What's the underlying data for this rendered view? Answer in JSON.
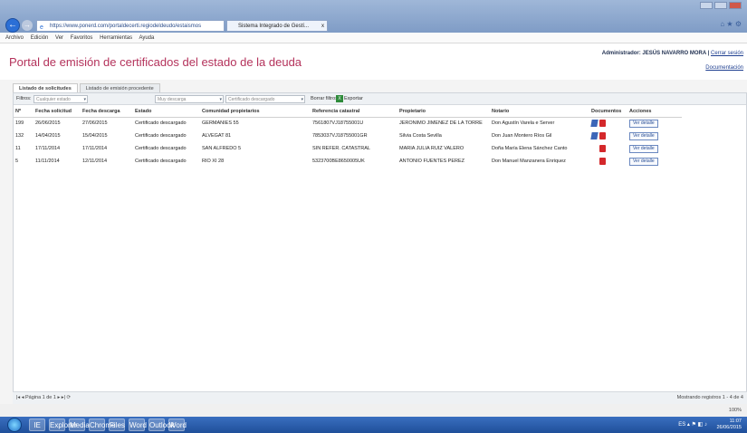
{
  "browser": {
    "address": "https://www.ponerd.com/portaldecerti.regiodeldeudo/estaismos",
    "tab_label": "Sistema Integrado de Gestí...",
    "tab_close": "x"
  },
  "menu": [
    "Archivo",
    "Edición",
    "Ver",
    "Favoritos",
    "Herramientas",
    "Ayuda"
  ],
  "header": {
    "title": "Portal de emisión de certificados del estado de la deuda",
    "user": "Administrador: JESÚS NAVARRO MORA |",
    "logout": "Cerrar sesión",
    "docs": "Documentación"
  },
  "tabs": [
    "Listado de solicitudes",
    "Listado de emisión procedente"
  ],
  "toolbar": {
    "filter_label": "Filtros:",
    "filter1": "Cualquier estado",
    "filter2": "Muy descarga",
    "filter3": "Certificado descargado",
    "clear": "Borrar filtros",
    "export": "Exportar",
    "export_icon": "X"
  },
  "columns": [
    "Nº",
    "Fecha solicitud",
    "Fecha descarga",
    "Estado",
    "Comunidad propietarios",
    "Referencia catastral",
    "Propietario",
    "Notario",
    "Documentos",
    "Acciones"
  ],
  "rows": [
    {
      "n": "199",
      "fsol": "26/06/2015",
      "fdes": "27/06/2015",
      "estado": "Certificado descargado",
      "comunidad": "GERMANIES 55",
      "ref": "7561807VJ18755001U",
      "prop": "JERONIMO JIMENEZ DE LA TORRE",
      "notario": "Don Agustín Varela e Server",
      "docs": "edit,pdf",
      "accion": "Ver detalle"
    },
    {
      "n": "132",
      "fsol": "14/04/2015",
      "fdes": "15/04/2015",
      "estado": "Certificado descargado",
      "comunidad": "ALVEGAT 81",
      "ref": "7853037VJ18755001GR",
      "prop": "Silvia Costa Sevilla",
      "notario": "Don Juan Montero Ríos Gil",
      "docs": "edit,pdf",
      "accion": "Ver detalle"
    },
    {
      "n": "11",
      "fsol": "17/11/2014",
      "fdes": "17/11/2014",
      "estado": "Certificado descargado",
      "comunidad": "SAN ALFREDO 5",
      "ref": "SIN REFER. CATASTRAL",
      "prop": "MARIA JULIA RUIZ VALERO",
      "notario": "Doña María Elena Sánchez Canto",
      "docs": "pdf",
      "accion": "Ver detalle"
    },
    {
      "n": "5",
      "fsol": "11/11/2014",
      "fdes": "12/11/2014",
      "estado": "Certificado descargado",
      "comunidad": "RIO XI 28",
      "ref": "5323700BE8650005UK",
      "prop": "ANTONIO FUENTES PEREZ",
      "notario": "Don Manuel Manzanera Enriquez",
      "docs": "pdf",
      "accion": "Ver detalle"
    }
  ],
  "footer": {
    "pager": "|◂  ◂  Página  1 de 1  ▸  ▸|  ⟳",
    "count": "Mostrando registros 1 - 4 de 4"
  },
  "status": {
    "zoom": "100%"
  },
  "taskbar": {
    "apps": [
      "IE",
      "Explorer",
      "Media",
      "Chrome",
      "Files",
      "Word",
      "Outlook",
      "Word"
    ],
    "time": "11:07",
    "date": "26/06/2015",
    "tray": "ES  ▴  ⚑  ◧  ♪"
  }
}
